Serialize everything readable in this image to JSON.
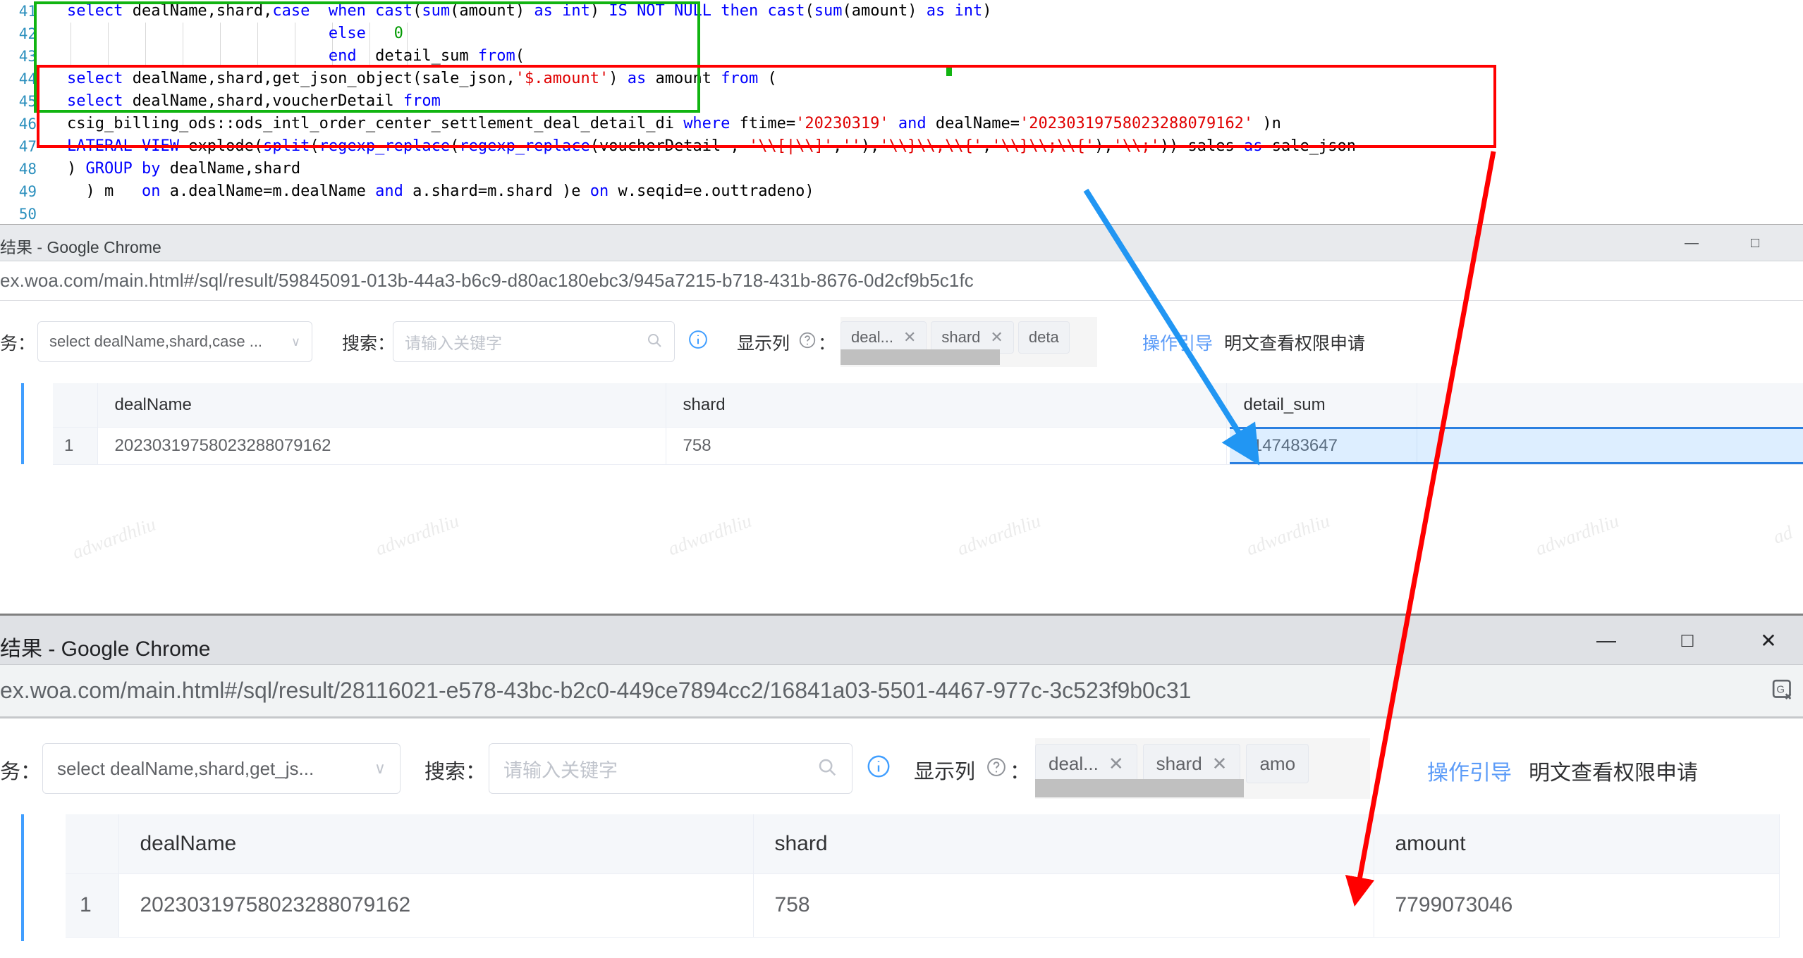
{
  "editor": {
    "lines": [
      {
        "num": "41",
        "segments": [
          {
            "t": "select ",
            "c": "kw"
          },
          {
            "t": "dealName,shard,",
            "c": "plain"
          },
          {
            "t": "case",
            "c": "kw"
          },
          {
            "t": "  ",
            "c": "plain"
          },
          {
            "t": "when",
            "c": "kw"
          },
          {
            "t": " ",
            "c": "plain"
          },
          {
            "t": "cast",
            "c": "kw"
          },
          {
            "t": "(",
            "c": "plain"
          },
          {
            "t": "sum",
            "c": "kw"
          },
          {
            "t": "(amount) ",
            "c": "plain"
          },
          {
            "t": "as",
            "c": "kw"
          },
          {
            "t": " ",
            "c": "plain"
          },
          {
            "t": "int",
            "c": "kw"
          },
          {
            "t": ") ",
            "c": "plain"
          },
          {
            "t": "IS NOT NULL",
            "c": "kw"
          },
          {
            "t": " ",
            "c": "plain"
          },
          {
            "t": "then",
            "c": "kw"
          },
          {
            "t": " ",
            "c": "plain"
          },
          {
            "t": "cast",
            "c": "kw"
          },
          {
            "t": "(",
            "c": "plain"
          },
          {
            "t": "sum",
            "c": "kw"
          },
          {
            "t": "(amount) ",
            "c": "plain"
          },
          {
            "t": "as",
            "c": "kw"
          },
          {
            "t": " ",
            "c": "plain"
          },
          {
            "t": "int",
            "c": "kw"
          },
          {
            "t": ")",
            "c": "plain"
          }
        ],
        "indent": 0,
        "guides": 0
      },
      {
        "num": "42",
        "segments": [
          {
            "t": "                            ",
            "c": "plain"
          },
          {
            "t": "else",
            "c": "kw"
          },
          {
            "t": "   ",
            "c": "plain"
          },
          {
            "t": "0",
            "c": "num"
          }
        ],
        "indent": 0,
        "guides": 10
      },
      {
        "num": "43",
        "segments": [
          {
            "t": "                            ",
            "c": "plain"
          },
          {
            "t": "end",
            "c": "kw"
          },
          {
            "t": "  detail_sum ",
            "c": "plain"
          },
          {
            "t": "from",
            "c": "kw"
          },
          {
            "t": "(",
            "c": "plain"
          }
        ],
        "indent": 0,
        "guides": 10
      },
      {
        "num": "44",
        "segments": [
          {
            "t": "select",
            "c": "kw"
          },
          {
            "t": " dealName,shard,get_json_object(sale_json,",
            "c": "plain"
          },
          {
            "t": "'$.amount'",
            "c": "str"
          },
          {
            "t": ") ",
            "c": "plain"
          },
          {
            "t": "as",
            "c": "kw"
          },
          {
            "t": " amount ",
            "c": "plain"
          },
          {
            "t": "from",
            "c": "kw"
          },
          {
            "t": " (",
            "c": "plain"
          }
        ],
        "indent": 0,
        "guides": 0
      },
      {
        "num": "45",
        "segments": [
          {
            "t": "select",
            "c": "kw"
          },
          {
            "t": " dealName,shard,voucherDetail ",
            "c": "plain"
          },
          {
            "t": "from",
            "c": "kw"
          }
        ],
        "indent": 0,
        "guides": 0
      },
      {
        "num": "46",
        "segments": [
          {
            "t": "csig_billing_ods::ods_intl_order_center_settlement_deal_detail_di ",
            "c": "plain"
          },
          {
            "t": "where",
            "c": "kw"
          },
          {
            "t": " ftime=",
            "c": "plain"
          },
          {
            "t": "'20230319'",
            "c": "str"
          },
          {
            "t": " ",
            "c": "plain"
          },
          {
            "t": "and",
            "c": "kw"
          },
          {
            "t": " dealName=",
            "c": "plain"
          },
          {
            "t": "'20230319758023288079162'",
            "c": "str"
          },
          {
            "t": " )n",
            "c": "plain"
          }
        ],
        "indent": 0,
        "guides": 0
      },
      {
        "num": "47",
        "segments": [
          {
            "t": "LATERAL VIEW",
            "c": "kw"
          },
          {
            "t": " explode(",
            "c": "plain"
          },
          {
            "t": "split",
            "c": "kw"
          },
          {
            "t": "(",
            "c": "plain"
          },
          {
            "t": "regexp_replace",
            "c": "kw"
          },
          {
            "t": "(",
            "c": "plain"
          },
          {
            "t": "regexp_replace",
            "c": "kw"
          },
          {
            "t": "(voucherDetail , ",
            "c": "plain"
          },
          {
            "t": "'\\\\[|\\\\]'",
            "c": "str"
          },
          {
            "t": ",",
            "c": "plain"
          },
          {
            "t": "''",
            "c": "str"
          },
          {
            "t": "),",
            "c": "plain"
          },
          {
            "t": "'\\\\}\\\\,\\\\{'",
            "c": "str"
          },
          {
            "t": ",",
            "c": "plain"
          },
          {
            "t": "'\\\\}\\\\;\\\\{'",
            "c": "str"
          },
          {
            "t": "),",
            "c": "plain"
          },
          {
            "t": "'\\\\;'",
            "c": "str"
          },
          {
            "t": ")) sales ",
            "c": "plain"
          },
          {
            "t": "as",
            "c": "kw"
          },
          {
            "t": " sale_json",
            "c": "plain"
          }
        ],
        "indent": 0,
        "guides": 0
      },
      {
        "num": "48",
        "segments": [
          {
            "t": ") ",
            "c": "plain"
          },
          {
            "t": "GROUP",
            "c": "kw"
          },
          {
            "t": " ",
            "c": "plain"
          },
          {
            "t": "by",
            "c": "kw"
          },
          {
            "t": " dealName,shard",
            "c": "plain"
          }
        ],
        "indent": 0,
        "guides": 0
      },
      {
        "num": "49",
        "segments": [
          {
            "t": "  ) m   ",
            "c": "plain"
          },
          {
            "t": "on",
            "c": "kw"
          },
          {
            "t": " a.dealName=m.dealName ",
            "c": "plain"
          },
          {
            "t": "and",
            "c": "kw"
          },
          {
            "t": " a.shard=m.shard )e ",
            "c": "plain"
          },
          {
            "t": "on",
            "c": "kw"
          },
          {
            "t": " w.seqid=e.outtradeno)",
            "c": "plain"
          }
        ],
        "indent": 0,
        "guides": 0
      },
      {
        "num": "50",
        "segments": [
          {
            "t": "",
            "c": "plain"
          }
        ],
        "indent": 0,
        "guides": 0
      }
    ]
  },
  "window1": {
    "title": "结果 - Google Chrome",
    "minimize_label": "—",
    "maximize_label": "□",
    "url": "ex.woa.com/main.html#/sql/result/59845091-013b-44a3-b6c9-d80ac180ebc3/945a7215-b718-431b-8676-0d2cf9b5c1fc",
    "toolbar": {
      "task_label": "务：",
      "task_value": "select dealName,shard,case ...",
      "search_label": "搜索：",
      "search_placeholder": "请输入关键字",
      "search_value": "",
      "columns_label": "显示列",
      "colon": "：",
      "tags": [
        "deal...",
        "shard",
        "deta"
      ],
      "tag_close": "✕",
      "link_guide": "操作引导",
      "link_permission": "明文查看权限申请"
    },
    "table": {
      "headers": [
        "dealName",
        "shard",
        "detail_sum"
      ],
      "rows": [
        {
          "index": "1",
          "cells": [
            "20230319758023288079162",
            "758",
            "2147483647"
          ]
        }
      ]
    },
    "watermarks": [
      "adwardhliu",
      "adwardhliu",
      "adwardhliu",
      "adwardhliu",
      "adwardhliu",
      "adwardhliu",
      "ad"
    ]
  },
  "window2": {
    "title": "结果 - Google Chrome",
    "minimize_label": "—",
    "maximize_label": "□",
    "close_label": "✕",
    "url": "ex.woa.com/main.html#/sql/result/28116021-e578-43bc-b2c0-449ce7894cc2/16841a03-5501-4467-977c-3c523f9b0c31",
    "translate_icon": "translate-icon",
    "toolbar": {
      "task_label": "务：",
      "task_value": "select dealName,shard,get_js...",
      "search_label": "搜索：",
      "search_placeholder": "请输入关键字",
      "search_value": "",
      "columns_label": "显示列",
      "colon": "：",
      "tags": [
        "deal...",
        "shard",
        "amo"
      ],
      "tag_close": "✕",
      "link_guide": "操作引导",
      "link_permission": "明文查看权限申请"
    },
    "table": {
      "headers": [
        "dealName",
        "shard",
        "amount"
      ],
      "rows": [
        {
          "index": "1",
          "cells": [
            "20230319758023288079162",
            "758",
            "7799073046"
          ]
        }
      ]
    }
  },
  "annotations": {
    "green_box_color": "#11b411",
    "red_box_color": "#ff0000",
    "blue_arrow_color": "#2196f3",
    "red_arrow_color": "#ff0000"
  }
}
